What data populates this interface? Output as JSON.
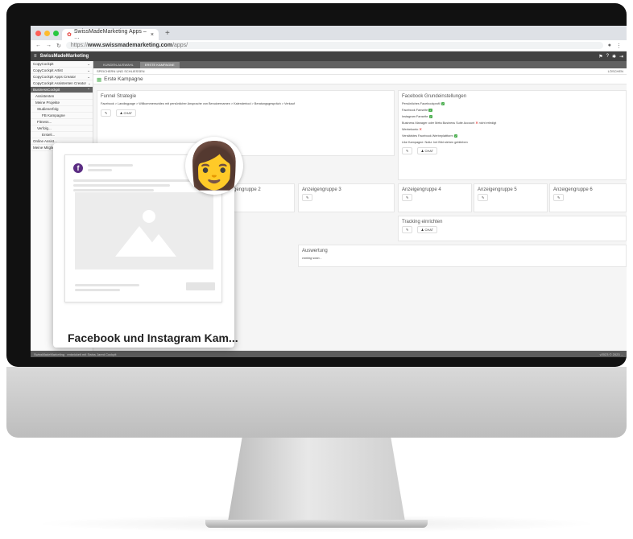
{
  "browser": {
    "tab_title": "SwissMadeMarketing Apps – …",
    "url_prefix": "https://",
    "url_domain": "www.swissmademarketing.com",
    "url_path": "/apps/"
  },
  "app": {
    "name": "SwissMadeMarketing",
    "save_label": "SPEICHERN UND SCHLIESSEN",
    "delete_label": "LÖSCHEN"
  },
  "sidebar": {
    "items": [
      {
        "label": "CopyCockpit"
      },
      {
        "label": "CopyCockpit Artist"
      },
      {
        "label": "CopyCockpit Apps Creator"
      },
      {
        "label": "CopyCockpit Assistenten Creator"
      },
      {
        "label": "BusinessCockpit"
      },
      {
        "label": "Assistenten"
      },
      {
        "label": "Meine Projekte"
      },
      {
        "label": "Studienerfolg"
      },
      {
        "label": "FB Kampagne"
      },
      {
        "label": "Fitness..."
      },
      {
        "label": "Verfolg..."
      },
      {
        "label": "Ersteli..."
      },
      {
        "label": "Online Assist..."
      },
      {
        "label": "Meine Mitglie..."
      }
    ]
  },
  "subtabs": [
    "KUNDEN-AUSWAHL",
    "ERSTE KAMPAGNE"
  ],
  "kampagne_title": "Erste Kampagne",
  "funnel": {
    "title": "Funnel Strategie",
    "text": "Facebook > Landingpage > Willkommensvideo mit persönlicher Ansprache von Benutzernamen > Kalendertool > Beratungsgespräch > Verkauf",
    "chat_label": "CHAT"
  },
  "fb_settings": {
    "title": "Facebook Grundeinstellungen",
    "lines": [
      "Persönliches Facebookprofil",
      "Facebook Fanseite",
      "Instagram Fanseite",
      "Business Manager oder Meta Business Suite Account",
      "Werbekonto",
      "Verstärktes Facebook Werbeplattform",
      "Like Kampagne: Notiz: bei Bild stehen geblieben"
    ],
    "manager_note": "nicht erledigt",
    "chat_label": "CHAT"
  },
  "groups": [
    {
      "label": "Anzeigengruppe 2"
    },
    {
      "label": "Anzeigengruppe 3"
    },
    {
      "label": "Anzeigengruppe 4"
    },
    {
      "label": "Anzeigengruppe 5"
    },
    {
      "label": "Anzeigengruppe 6"
    }
  ],
  "tracking": {
    "title": "Tracking einrichten",
    "chat_label": "CHAT"
  },
  "auswertung": {
    "title": "Auswertung",
    "text": "coming soon..."
  },
  "statusbar": {
    "left": "SwissMadeMarketing",
    "middle": "entwickelt mit Swiss Jared Cockpit",
    "right": "v2023 © 2023 ..."
  },
  "overlay": {
    "title": "Facebook und Instagram Kam...",
    "fb_letter": "f",
    "avatar_emoji": "👩"
  },
  "icons": [
    "chevron-down-icon",
    "edit-icon",
    "user-add-icon",
    "flag-icon",
    "help-icon",
    "settings-icon",
    "logout-icon",
    "check-icon",
    "cross-icon",
    "facebook-icon",
    "image-placeholder-icon"
  ],
  "colors": {
    "accent_green": "#4caf50",
    "cross_red": "#e53935",
    "app_bar": "#424242",
    "fb_purple": "#5b2d83"
  }
}
